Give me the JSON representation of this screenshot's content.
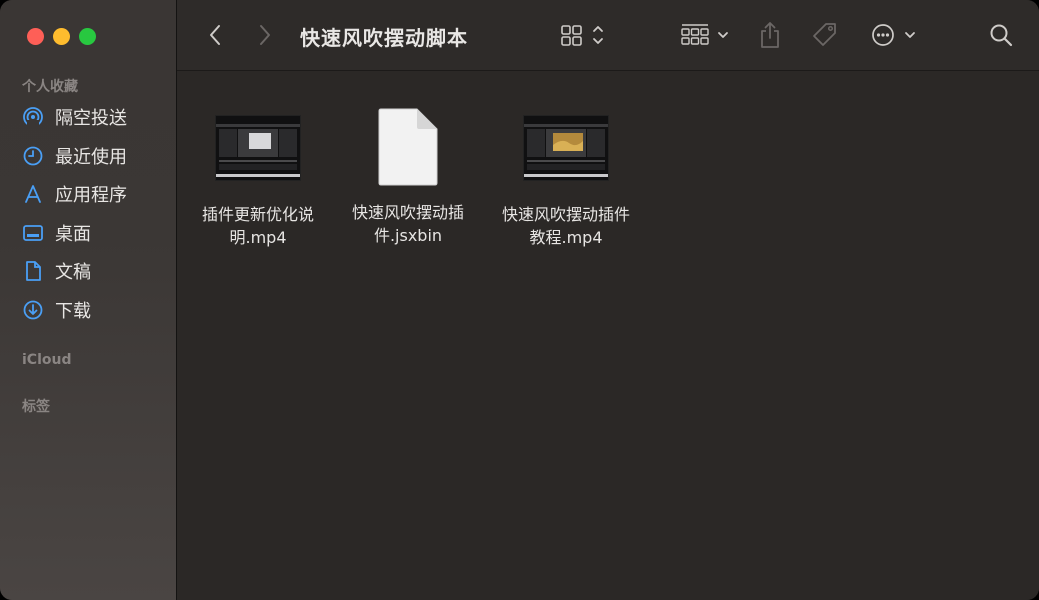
{
  "window": {
    "title": "快速风吹摆动脚本"
  },
  "sidebar": {
    "favorites_title": "个人收藏",
    "items": [
      {
        "label": "隔空投送",
        "icon": "airdrop-icon"
      },
      {
        "label": "最近使用",
        "icon": "clock-icon"
      },
      {
        "label": "应用程序",
        "icon": "applications-icon"
      },
      {
        "label": "桌面",
        "icon": "desktop-icon"
      },
      {
        "label": "文稿",
        "icon": "document-icon"
      },
      {
        "label": "下载",
        "icon": "download-icon"
      }
    ],
    "icloud_title": "iCloud",
    "tags_title": "标签"
  },
  "files": [
    {
      "name_line1": "插件更新优化说",
      "name_line2": "明.mp4",
      "kind": "video"
    },
    {
      "name_line1": "快速风吹摆动插",
      "name_line2": "件.jsxbin",
      "kind": "document"
    },
    {
      "name_line1": "快速风吹摆动插件",
      "name_line2": "教程.mp4",
      "kind": "video"
    }
  ],
  "colors": {
    "accent": "#4a9ff5",
    "close": "#fe5f57",
    "minimize": "#febc2e",
    "zoom": "#28c840"
  }
}
